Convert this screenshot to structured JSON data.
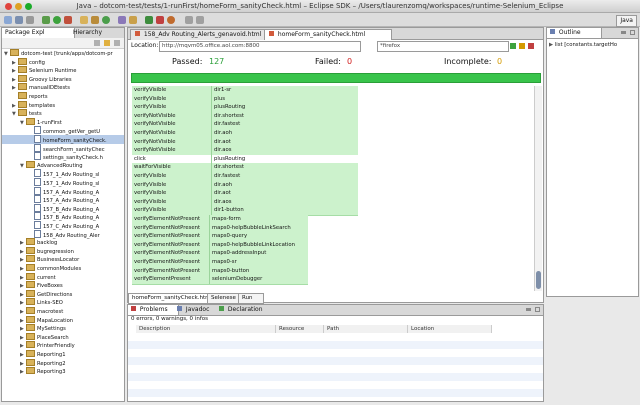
{
  "window": {
    "title": "Java – dotcom-test/tests/1-runFirst/homeForm_sanityCheck.html – Eclipse SDK – /Users/tlaurenzomq/workspaces/runtime-Selenium_Eclipse",
    "perspective": "Java"
  },
  "left_panel": {
    "tabs": [
      "Package Expl",
      "Hierarchy"
    ],
    "tree": [
      {
        "label": "dotcom-test [trunk/apps/dotcom-pr",
        "indent": 0,
        "twist": "▼",
        "icon": "folder"
      },
      {
        "label": "config",
        "indent": 1,
        "twist": "▶",
        "icon": "folder"
      },
      {
        "label": "Selenium Runtime",
        "indent": 1,
        "twist": "▶",
        "icon": "folder"
      },
      {
        "label": "Groovy Libraries",
        "indent": 1,
        "twist": "▶",
        "icon": "folder"
      },
      {
        "label": "manualIDEtests",
        "indent": 1,
        "twist": "▶",
        "icon": "folder"
      },
      {
        "label": "reports",
        "indent": 1,
        "twist": "",
        "icon": "folder"
      },
      {
        "label": "templates",
        "indent": 1,
        "twist": "▶",
        "icon": "folder"
      },
      {
        "label": "tests",
        "indent": 1,
        "twist": "▼",
        "icon": "folder"
      },
      {
        "label": "1-runFirst",
        "indent": 2,
        "twist": "▼",
        "icon": "folder"
      },
      {
        "label": "common_getVer_getU",
        "indent": 3,
        "twist": "",
        "icon": "file"
      },
      {
        "label": "homeForm_sanityCheck.",
        "indent": 3,
        "twist": "",
        "icon": "file",
        "selected": true
      },
      {
        "label": "searchForm_sanityChec",
        "indent": 3,
        "twist": "",
        "icon": "file"
      },
      {
        "label": "settings_sanityCheck.h",
        "indent": 3,
        "twist": "",
        "icon": "file"
      },
      {
        "label": "AdvancedRouting",
        "indent": 2,
        "twist": "▼",
        "icon": "folder"
      },
      {
        "label": "157_1_Adv Routing_sl",
        "indent": 3,
        "twist": "",
        "icon": "file"
      },
      {
        "label": "157_1_Adv Routing_sl",
        "indent": 3,
        "twist": "",
        "icon": "file"
      },
      {
        "label": "157_A_Adv Routing_A",
        "indent": 3,
        "twist": "",
        "icon": "file"
      },
      {
        "label": "157_A_Adv Routing_A",
        "indent": 3,
        "twist": "",
        "icon": "file"
      },
      {
        "label": "157_B_Adv Routing_A",
        "indent": 3,
        "twist": "",
        "icon": "file"
      },
      {
        "label": "157_B_Adv Routing_A",
        "indent": 3,
        "twist": "",
        "icon": "file"
      },
      {
        "label": "157_C_Adv Routing_A",
        "indent": 3,
        "twist": "",
        "icon": "file"
      },
      {
        "label": "158_Adv Routing_Aler",
        "indent": 3,
        "twist": "",
        "icon": "file"
      },
      {
        "label": "backlog",
        "indent": 2,
        "twist": "▶",
        "icon": "folder"
      },
      {
        "label": "bugregression",
        "indent": 2,
        "twist": "▶",
        "icon": "folder"
      },
      {
        "label": "BusinessLocator",
        "indent": 2,
        "twist": "▶",
        "icon": "folder"
      },
      {
        "label": "commonModules",
        "indent": 2,
        "twist": "▶",
        "icon": "folder"
      },
      {
        "label": "current",
        "indent": 2,
        "twist": "▶",
        "icon": "folder"
      },
      {
        "label": "FiveBoxes",
        "indent": 2,
        "twist": "▶",
        "icon": "folder"
      },
      {
        "label": "GetDirections",
        "indent": 2,
        "twist": "▶",
        "icon": "folder"
      },
      {
        "label": "Links-SEO",
        "indent": 2,
        "twist": "▶",
        "icon": "folder"
      },
      {
        "label": "macrotest",
        "indent": 2,
        "twist": "▶",
        "icon": "folder"
      },
      {
        "label": "MapaLocation",
        "indent": 2,
        "twist": "▶",
        "icon": "folder"
      },
      {
        "label": "MySettings",
        "indent": 2,
        "twist": "▶",
        "icon": "folder"
      },
      {
        "label": "PlaceSearch",
        "indent": 2,
        "twist": "▶",
        "icon": "folder"
      },
      {
        "label": "PrinterFriendly",
        "indent": 2,
        "twist": "▶",
        "icon": "folder"
      },
      {
        "label": "Reporting1",
        "indent": 2,
        "twist": "▶",
        "icon": "folder"
      },
      {
        "label": "Reporting2",
        "indent": 2,
        "twist": "▶",
        "icon": "folder"
      },
      {
        "label": "Reporting3",
        "indent": 2,
        "twist": "▶",
        "icon": "folder"
      }
    ]
  },
  "editor": {
    "tabs": [
      {
        "label": "158_Adv Routing_Alerts_genavoid.html",
        "active": false
      },
      {
        "label": "homeForm_sanityCheck.html",
        "active": true
      }
    ],
    "location_label": "Location:",
    "location_value": "http://mqvm05.office.aol.com:8800",
    "browser_value": "*firefox",
    "passed_label": "Passed:",
    "passed_value": "127",
    "failed_label": "Failed:",
    "failed_value": "0",
    "incomplete_label": "Incomplete:",
    "incomplete_value": "0",
    "progress_fraction": 1.0,
    "rows": [
      {
        "cmd": "verifyVisible",
        "target": "dir1-sr",
        "status": "pass"
      },
      {
        "cmd": "verifyVisible",
        "target": "plus",
        "status": "pass"
      },
      {
        "cmd": "verifyVisible",
        "target": "plusRouting",
        "status": "pass"
      },
      {
        "cmd": "verifyNotVisible",
        "target": "dir.shortest",
        "status": "pass"
      },
      {
        "cmd": "verifyNotVisible",
        "target": "dir.fastest",
        "status": "pass"
      },
      {
        "cmd": "verifyNotVisible",
        "target": "dir.aoh",
        "status": "pass"
      },
      {
        "cmd": "verifyNotVisible",
        "target": "dir.aot",
        "status": "pass"
      },
      {
        "cmd": "verifyNotVisible",
        "target": "dir.aos",
        "status": "pass"
      },
      {
        "cmd": "click",
        "target": "plusRouting",
        "status": "none"
      },
      {
        "cmd": "waitForVisible",
        "target": "dir.shortest",
        "status": "pass"
      },
      {
        "cmd": "verifyVisible",
        "target": "dir.fastest",
        "status": "pass"
      },
      {
        "cmd": "verifyVisible",
        "target": "dir.aoh",
        "status": "pass"
      },
      {
        "cmd": "verifyVisible",
        "target": "dir.aot",
        "status": "pass"
      },
      {
        "cmd": "verifyVisible",
        "target": "dir.aos",
        "status": "pass"
      },
      {
        "cmd": "verifyVisible",
        "target": "dir1-button",
        "status": "pass"
      },
      {
        "cmd": "verifyElementNotPresent",
        "target": "maps-form",
        "status": "pass"
      },
      {
        "cmd": "verifyElementNotPresent",
        "target": "maps0-helpBubbleLinkSearch",
        "status": "pass"
      },
      {
        "cmd": "verifyElementNotPresent",
        "target": "maps0-query",
        "status": "pass"
      },
      {
        "cmd": "verifyElementNotPresent",
        "target": "maps0-helpBubbleLinkLocation",
        "status": "pass"
      },
      {
        "cmd": "verifyElementNotPresent",
        "target": "maps0-addressInput",
        "status": "pass"
      },
      {
        "cmd": "verifyElementNotPresent",
        "target": "maps0-sr",
        "status": "pass"
      },
      {
        "cmd": "verifyElementNotPresent",
        "target": "maps0-button",
        "status": "pass"
      },
      {
        "cmd": "verifyElementPresent",
        "target": "seleniumDebugger",
        "status": "pass"
      }
    ],
    "bottom_tabs": [
      "homeForm_sanityCheck.html",
      "Selenese",
      "Run"
    ]
  },
  "problems": {
    "tabs": [
      "Problems",
      "Javadoc",
      "Declaration"
    ],
    "summary": "0 errors, 0 warnings, 0 infos",
    "columns": [
      "Description",
      "Resource",
      "Path",
      "Location"
    ]
  },
  "outline": {
    "tab": "Outline",
    "item": "list [constants.targetHo"
  },
  "colors": {
    "pass_green": "#ccf2cc",
    "progress_green": "#39c44b",
    "passed_text": "#2a9f38",
    "failed_text": "#d11a1a",
    "incomplete_text": "#d49a00",
    "selection": "#b6cbe8"
  }
}
